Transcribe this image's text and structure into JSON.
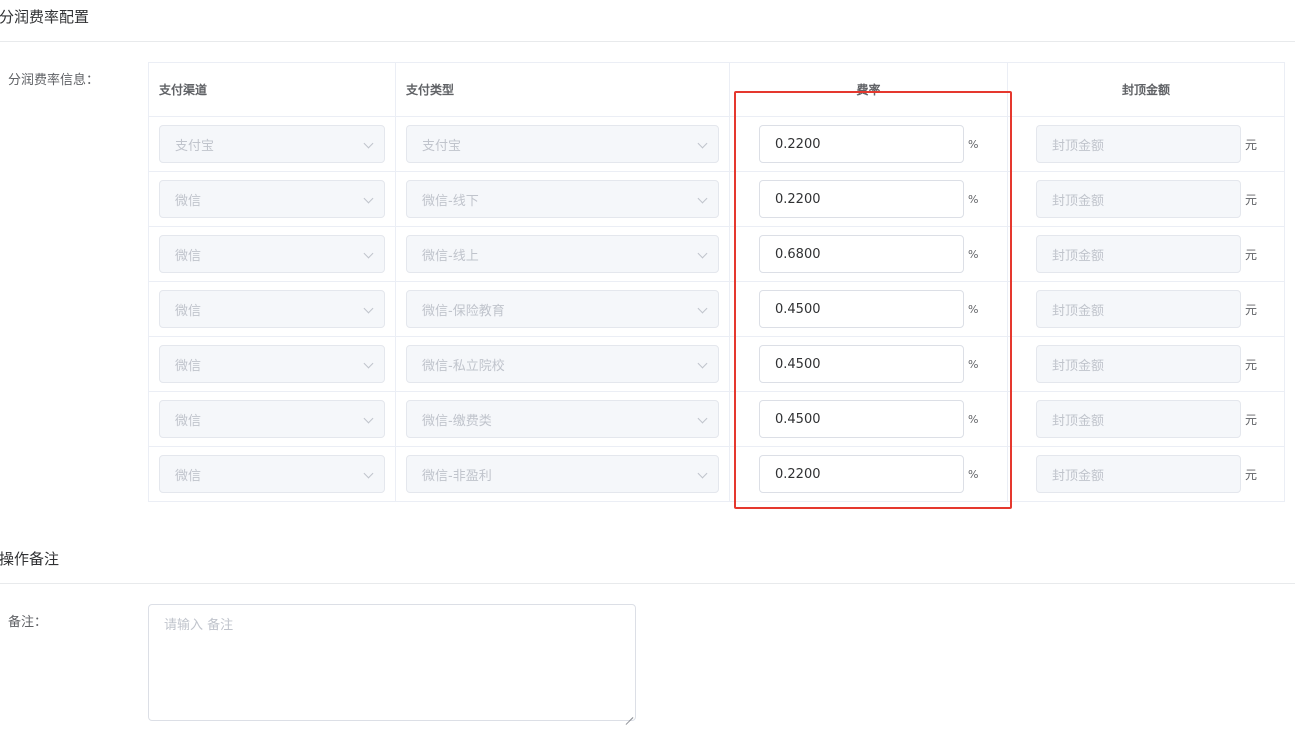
{
  "sections": {
    "rate_config_title": "分润费率配置",
    "remark_title": "操作备注"
  },
  "rate_info_label": "分润费率信息：",
  "table": {
    "headers": [
      "支付渠道",
      "支付类型",
      "费率",
      "封顶金额"
    ],
    "rate_unit": "%",
    "cap_unit": "元",
    "cap_placeholder": "封顶金额",
    "rows": [
      {
        "channel": "支付宝",
        "type": "支付宝",
        "rate": "0.2200"
      },
      {
        "channel": "微信",
        "type": "微信-线下",
        "rate": "0.2200"
      },
      {
        "channel": "微信",
        "type": "微信-线上",
        "rate": "0.6800"
      },
      {
        "channel": "微信",
        "type": "微信-保险教育",
        "rate": "0.4500"
      },
      {
        "channel": "微信",
        "type": "微信-私立院校",
        "rate": "0.4500"
      },
      {
        "channel": "微信",
        "type": "微信-缴费类",
        "rate": "0.4500"
      },
      {
        "channel": "微信",
        "type": "微信-非盈利",
        "rate": "0.2200"
      }
    ]
  },
  "remark": {
    "label": "备注：",
    "placeholder": "请输入 备注"
  },
  "colors": {
    "highlight": "#e5382e",
    "disabled_bg": "#f5f7fa",
    "border": "#ebeef5"
  }
}
